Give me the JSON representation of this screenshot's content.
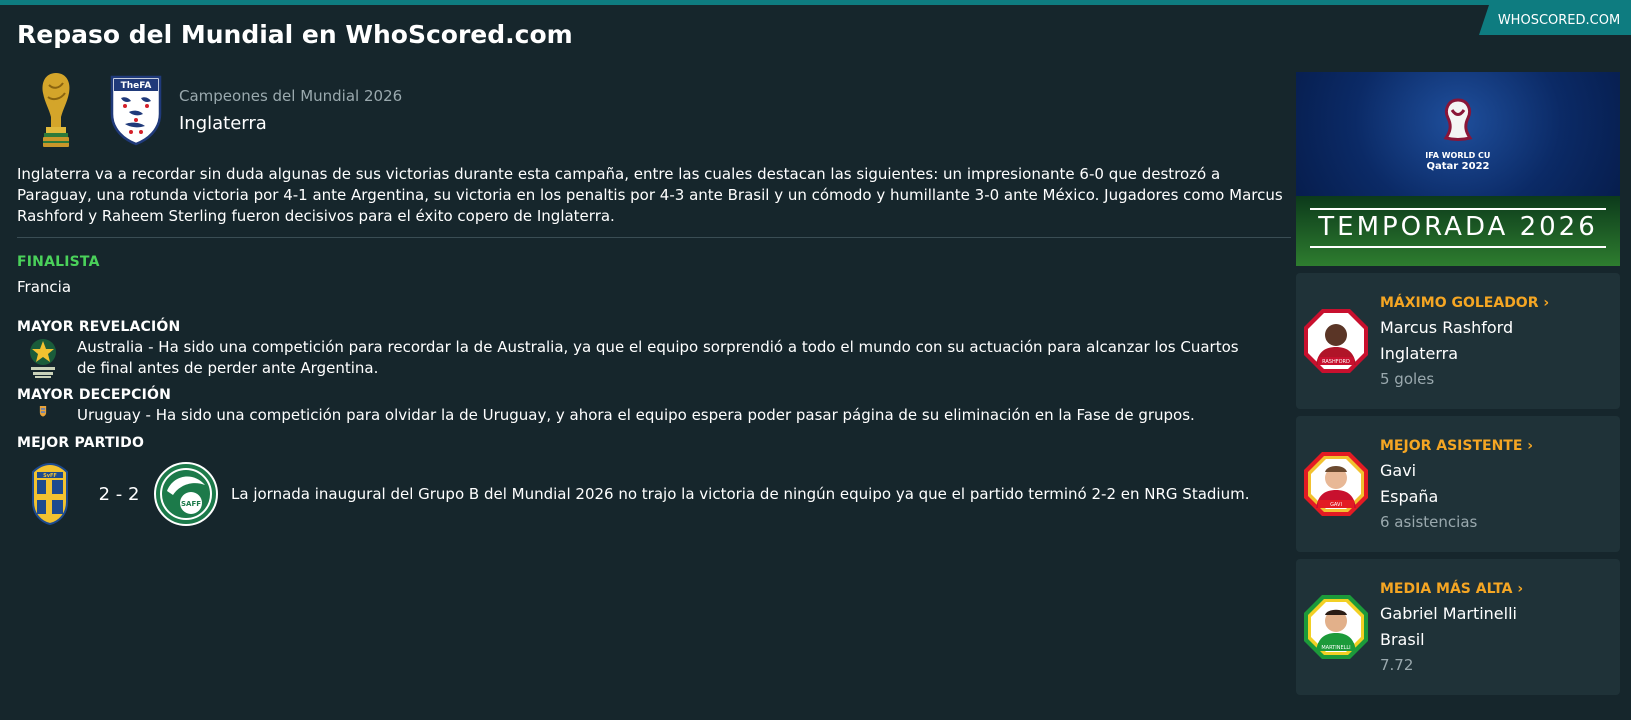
{
  "header": {
    "title": "Repaso del Mundial en WhoScored.com",
    "brand_link": "WHOSCORED.COM"
  },
  "champion": {
    "label": "Campeones del Mundial 2026",
    "team": "Inglaterra",
    "badge_text": "TheFA"
  },
  "summary": "Inglaterra va a recordar sin duda algunas de sus victorias durante esta campaña, entre las cuales destacan las siguientes: un impresionante 6-0 que destrozó a Paraguay, una rotunda victoria por 4-1 ante Argentina, su victoria en los penaltis por 4-3 ante Brasil y un cómodo y humillante 3-0 ante México. Jugadores como Marcus Rashford y Raheem Sterling fueron decisivos para el éxito copero de Inglaterra.",
  "finalist": {
    "label": "FINALISTA",
    "team": "Francia"
  },
  "revelation": {
    "label": "MAYOR REVELACIÓN",
    "text": "Australia - Ha sido una competición para recordar la de Australia, ya que el equipo sorprendió a todo el mundo con su actuación para alcanzar los Cuartos de final antes de perder ante Argentina."
  },
  "disappointment": {
    "label": "MAYOR DECEPCIÓN",
    "text": "Uruguay - Ha sido una competición para olvidar la de Uruguay, y ahora el equipo espera poder pasar página de su eliminación en la Fase de grupos."
  },
  "best_match": {
    "label": "MEJOR PARTIDO",
    "score": "2 - 2",
    "home_badge_text": "SvFF",
    "away_badge_text": "SAFF",
    "text": "La jornada inaugural del Grupo B del Mundial 2026 no trajo la victoria de ningún equipo ya que el partido terminó 2-2 en NRG Stadium."
  },
  "banner": {
    "event_line1": "FIFA WORLD CUP",
    "event_line2": "Qatar 2022",
    "season": "TEMPORADA 2026"
  },
  "stats": [
    {
      "title": "MÁXIMO GOLEADOR",
      "name": "Marcus Rashford",
      "team": "Inglaterra",
      "value": "5 goles",
      "card_label": "RASHFORD"
    },
    {
      "title": "MEJOR ASISTENTE",
      "name": "Gavi",
      "team": "España",
      "value": "6 asistencias",
      "card_label": "GAVI"
    },
    {
      "title": "MEDIA MÁS ALTA",
      "name": "Gabriel Martinelli",
      "team": "Brasil",
      "value": "7.72",
      "card_label": "MARTINELLI"
    }
  ],
  "colors": {
    "background": "#16262c",
    "accent_teal": "#0e7c80",
    "finalist_green": "#4ad15a",
    "stat_orange": "#f5a623",
    "muted_text": "#9aa9ae",
    "card_bg": "#1f3238"
  },
  "icons": {
    "trophy": "world-cup-trophy-icon",
    "champion_badge": "england-fa-badge-icon",
    "chevron": "chevron-right-icon"
  }
}
